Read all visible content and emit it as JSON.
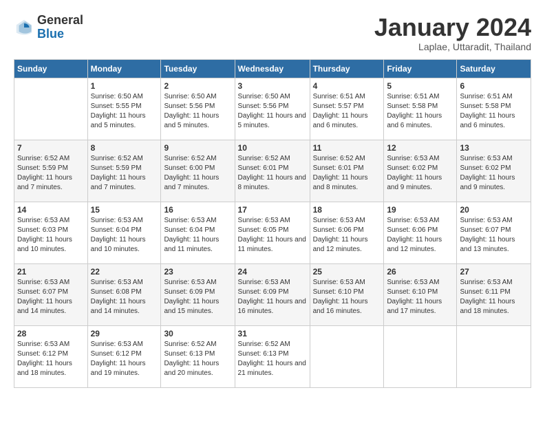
{
  "header": {
    "logo_general": "General",
    "logo_blue": "Blue",
    "month_title": "January 2024",
    "location": "Laplae, Uttaradit, Thailand"
  },
  "days_of_week": [
    "Sunday",
    "Monday",
    "Tuesday",
    "Wednesday",
    "Thursday",
    "Friday",
    "Saturday"
  ],
  "weeks": [
    [
      {
        "day": "",
        "sunrise": "",
        "sunset": "",
        "daylight": ""
      },
      {
        "day": "1",
        "sunrise": "Sunrise: 6:50 AM",
        "sunset": "Sunset: 5:55 PM",
        "daylight": "Daylight: 11 hours and 5 minutes."
      },
      {
        "day": "2",
        "sunrise": "Sunrise: 6:50 AM",
        "sunset": "Sunset: 5:56 PM",
        "daylight": "Daylight: 11 hours and 5 minutes."
      },
      {
        "day": "3",
        "sunrise": "Sunrise: 6:50 AM",
        "sunset": "Sunset: 5:56 PM",
        "daylight": "Daylight: 11 hours and 5 minutes."
      },
      {
        "day": "4",
        "sunrise": "Sunrise: 6:51 AM",
        "sunset": "Sunset: 5:57 PM",
        "daylight": "Daylight: 11 hours and 6 minutes."
      },
      {
        "day": "5",
        "sunrise": "Sunrise: 6:51 AM",
        "sunset": "Sunset: 5:58 PM",
        "daylight": "Daylight: 11 hours and 6 minutes."
      },
      {
        "day": "6",
        "sunrise": "Sunrise: 6:51 AM",
        "sunset": "Sunset: 5:58 PM",
        "daylight": "Daylight: 11 hours and 6 minutes."
      }
    ],
    [
      {
        "day": "7",
        "sunrise": "Sunrise: 6:52 AM",
        "sunset": "Sunset: 5:59 PM",
        "daylight": "Daylight: 11 hours and 7 minutes."
      },
      {
        "day": "8",
        "sunrise": "Sunrise: 6:52 AM",
        "sunset": "Sunset: 5:59 PM",
        "daylight": "Daylight: 11 hours and 7 minutes."
      },
      {
        "day": "9",
        "sunrise": "Sunrise: 6:52 AM",
        "sunset": "Sunset: 6:00 PM",
        "daylight": "Daylight: 11 hours and 7 minutes."
      },
      {
        "day": "10",
        "sunrise": "Sunrise: 6:52 AM",
        "sunset": "Sunset: 6:01 PM",
        "daylight": "Daylight: 11 hours and 8 minutes."
      },
      {
        "day": "11",
        "sunrise": "Sunrise: 6:52 AM",
        "sunset": "Sunset: 6:01 PM",
        "daylight": "Daylight: 11 hours and 8 minutes."
      },
      {
        "day": "12",
        "sunrise": "Sunrise: 6:53 AM",
        "sunset": "Sunset: 6:02 PM",
        "daylight": "Daylight: 11 hours and 9 minutes."
      },
      {
        "day": "13",
        "sunrise": "Sunrise: 6:53 AM",
        "sunset": "Sunset: 6:02 PM",
        "daylight": "Daylight: 11 hours and 9 minutes."
      }
    ],
    [
      {
        "day": "14",
        "sunrise": "Sunrise: 6:53 AM",
        "sunset": "Sunset: 6:03 PM",
        "daylight": "Daylight: 11 hours and 10 minutes."
      },
      {
        "day": "15",
        "sunrise": "Sunrise: 6:53 AM",
        "sunset": "Sunset: 6:04 PM",
        "daylight": "Daylight: 11 hours and 10 minutes."
      },
      {
        "day": "16",
        "sunrise": "Sunrise: 6:53 AM",
        "sunset": "Sunset: 6:04 PM",
        "daylight": "Daylight: 11 hours and 11 minutes."
      },
      {
        "day": "17",
        "sunrise": "Sunrise: 6:53 AM",
        "sunset": "Sunset: 6:05 PM",
        "daylight": "Daylight: 11 hours and 11 minutes."
      },
      {
        "day": "18",
        "sunrise": "Sunrise: 6:53 AM",
        "sunset": "Sunset: 6:06 PM",
        "daylight": "Daylight: 11 hours and 12 minutes."
      },
      {
        "day": "19",
        "sunrise": "Sunrise: 6:53 AM",
        "sunset": "Sunset: 6:06 PM",
        "daylight": "Daylight: 11 hours and 12 minutes."
      },
      {
        "day": "20",
        "sunrise": "Sunrise: 6:53 AM",
        "sunset": "Sunset: 6:07 PM",
        "daylight": "Daylight: 11 hours and 13 minutes."
      }
    ],
    [
      {
        "day": "21",
        "sunrise": "Sunrise: 6:53 AM",
        "sunset": "Sunset: 6:07 PM",
        "daylight": "Daylight: 11 hours and 14 minutes."
      },
      {
        "day": "22",
        "sunrise": "Sunrise: 6:53 AM",
        "sunset": "Sunset: 6:08 PM",
        "daylight": "Daylight: 11 hours and 14 minutes."
      },
      {
        "day": "23",
        "sunrise": "Sunrise: 6:53 AM",
        "sunset": "Sunset: 6:09 PM",
        "daylight": "Daylight: 11 hours and 15 minutes."
      },
      {
        "day": "24",
        "sunrise": "Sunrise: 6:53 AM",
        "sunset": "Sunset: 6:09 PM",
        "daylight": "Daylight: 11 hours and 16 minutes."
      },
      {
        "day": "25",
        "sunrise": "Sunrise: 6:53 AM",
        "sunset": "Sunset: 6:10 PM",
        "daylight": "Daylight: 11 hours and 16 minutes."
      },
      {
        "day": "26",
        "sunrise": "Sunrise: 6:53 AM",
        "sunset": "Sunset: 6:10 PM",
        "daylight": "Daylight: 11 hours and 17 minutes."
      },
      {
        "day": "27",
        "sunrise": "Sunrise: 6:53 AM",
        "sunset": "Sunset: 6:11 PM",
        "daylight": "Daylight: 11 hours and 18 minutes."
      }
    ],
    [
      {
        "day": "28",
        "sunrise": "Sunrise: 6:53 AM",
        "sunset": "Sunset: 6:12 PM",
        "daylight": "Daylight: 11 hours and 18 minutes."
      },
      {
        "day": "29",
        "sunrise": "Sunrise: 6:53 AM",
        "sunset": "Sunset: 6:12 PM",
        "daylight": "Daylight: 11 hours and 19 minutes."
      },
      {
        "day": "30",
        "sunrise": "Sunrise: 6:52 AM",
        "sunset": "Sunset: 6:13 PM",
        "daylight": "Daylight: 11 hours and 20 minutes."
      },
      {
        "day": "31",
        "sunrise": "Sunrise: 6:52 AM",
        "sunset": "Sunset: 6:13 PM",
        "daylight": "Daylight: 11 hours and 21 minutes."
      },
      {
        "day": "",
        "sunrise": "",
        "sunset": "",
        "daylight": ""
      },
      {
        "day": "",
        "sunrise": "",
        "sunset": "",
        "daylight": ""
      },
      {
        "day": "",
        "sunrise": "",
        "sunset": "",
        "daylight": ""
      }
    ]
  ]
}
